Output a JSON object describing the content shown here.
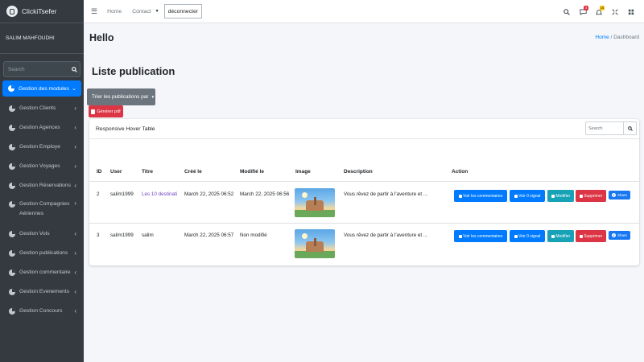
{
  "app": {
    "brand": "ClickiTsefer",
    "user": "SALIM MAHFOUDHI"
  },
  "sidebar": {
    "search_placeholder": "Search",
    "active_item": "Gestion des modules",
    "items": [
      {
        "label": "Gestion Clients"
      },
      {
        "label": "Gestion Agences"
      },
      {
        "label": "Gestion Employe"
      },
      {
        "label": "Gestion Voyages"
      },
      {
        "label": "Gestion Réservations"
      },
      {
        "label": "Gestion Compagnies Aériennes"
      },
      {
        "label": "Gestion Vols"
      },
      {
        "label": "Gestion publications"
      },
      {
        "label": "Gestion commentaire"
      },
      {
        "label": "Gestion Evenements"
      },
      {
        "label": "Gestion Concours"
      }
    ]
  },
  "topbar": {
    "home": "Home",
    "contact": "Contact",
    "logout": "déconnecter",
    "messages_badge": "3",
    "notifications_badge": "15"
  },
  "header": {
    "title": "Hello",
    "breadcrumb_home": "Home",
    "breadcrumb_sep": "/",
    "breadcrumb_current": "Dashboard"
  },
  "main": {
    "section_title": "Liste publication",
    "sort_button": "Trier les publications par",
    "pdf_button": "Générer pdf"
  },
  "card": {
    "title": "Responsive Hover Table",
    "search_placeholder": "Search",
    "columns": [
      "ID",
      "User",
      "Titre",
      "Créé le",
      "Modifié le",
      "Image",
      "Description",
      "Action"
    ],
    "rows": [
      {
        "id": "2",
        "user": "salim1999",
        "titre": "Les 10 destinati",
        "cree": "March 22, 2025 06:52",
        "modifie": "March 22, 2025 06:56",
        "description": "Vous rêvez de partir à l'aventure et ..."
      },
      {
        "id": "3",
        "user": "salim1999",
        "titre": "salim",
        "cree": "March 22, 2025 06:57",
        "modifie": "Non modifié",
        "description": "Vous rêvez de partir à l'aventure et ..."
      }
    ],
    "actions": {
      "view_comments": "Voir les commentaires",
      "view_reports": "Voir 0 signal",
      "edit": "Modifier",
      "delete": "Supprimer",
      "share": "Share"
    }
  },
  "colors": {
    "sidebar_bg": "#343a40",
    "primary": "#007bff",
    "danger": "#dc3545",
    "info": "#17a2b8",
    "secondary": "#6c757d",
    "facebook": "#1877f2"
  }
}
